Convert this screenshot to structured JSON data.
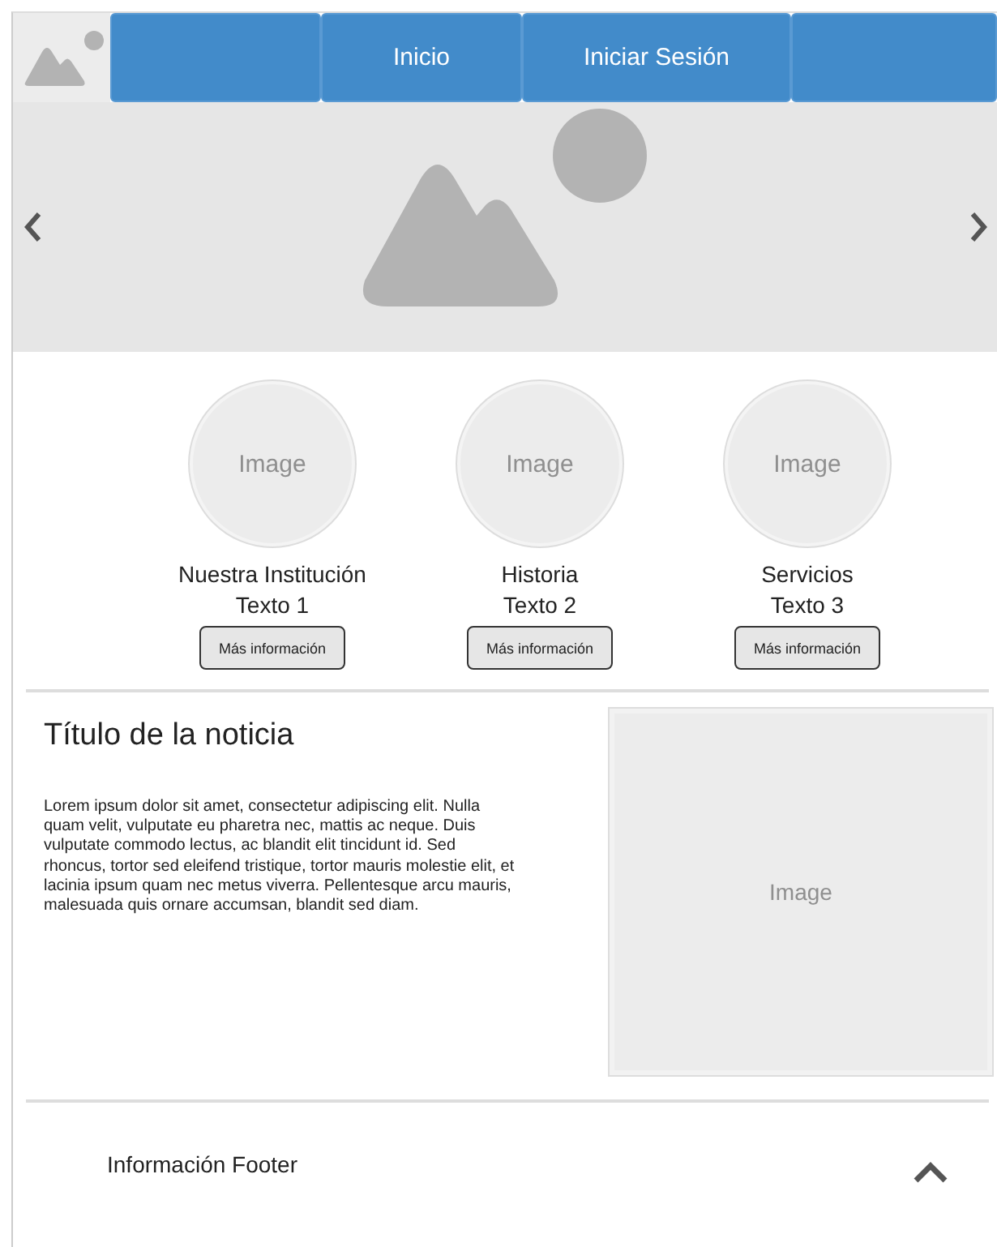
{
  "nav_items": [
    {
      "kind": "blank"
    },
    {
      "kind": "link",
      "label": "Inicio"
    },
    {
      "kind": "link",
      "label": "Iniciar Sesión"
    },
    {
      "kind": "blank"
    }
  ],
  "cards": [
    {
      "image_label": "Image",
      "title": "Nuestra Institución",
      "subtitle": "Texto 1",
      "button": "Más información"
    },
    {
      "image_label": "Image",
      "title": "Historia",
      "subtitle": "Texto 2",
      "button": "Más información"
    },
    {
      "image_label": "Image",
      "title": "Servicios",
      "subtitle": "Texto 3",
      "button": "Más información"
    }
  ],
  "news": {
    "title": "Título de la noticia",
    "body": "Lorem ipsum dolor sit amet, consectetur adipiscing elit. Nulla quam velit, vulputate eu pharetra nec, mattis ac neque. Duis vulputate commodo lectus, ac blandit elit tincidunt id. Sed rhoncus, tortor sed eleifend tristique, tortor mauris molestie elit, et lacinia ipsum quam nec metus viverra. Pellentesque arcu mauris, malesuada quis ornare accumsan, blandit sed diam.",
    "image_label": "Image"
  },
  "footer": {
    "text": "Información Footer",
    "expanded": true
  }
}
